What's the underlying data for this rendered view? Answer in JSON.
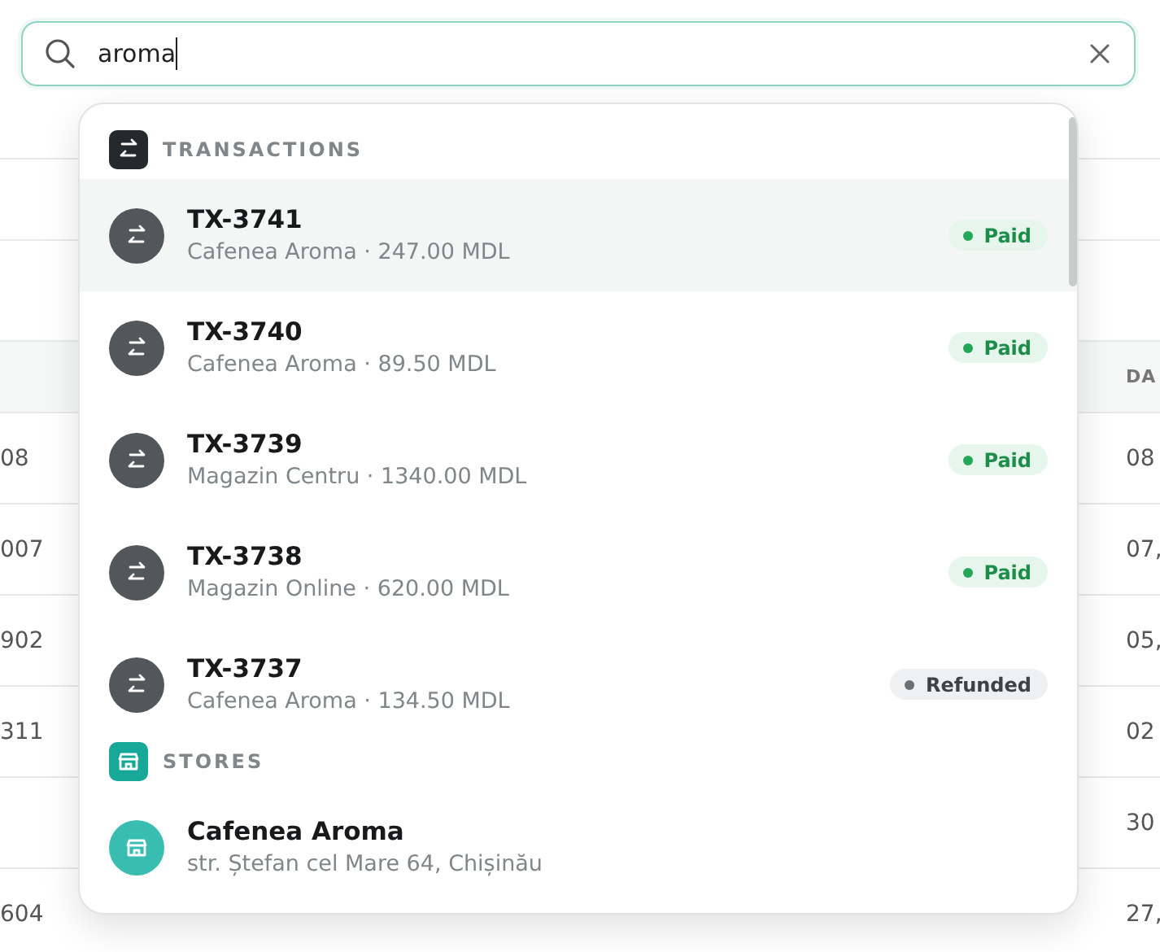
{
  "search": {
    "value": "aroma"
  },
  "table": {
    "header": [
      "DA"
    ],
    "rows": [
      {
        "cells": [
          "08",
          "",
          "",
          "",
          "08"
        ]
      },
      {
        "cells": [
          "007",
          "",
          "",
          "",
          "07,"
        ]
      },
      {
        "cells": [
          "902",
          "",
          "",
          "",
          "05,"
        ]
      },
      {
        "cells": [
          "311",
          "",
          "",
          "",
          "02"
        ]
      },
      {
        "cells": [
          "",
          "",
          "",
          "",
          "30"
        ]
      },
      {
        "cells": [
          "604",
          "",
          "",
          "",
          "27,"
        ]
      }
    ]
  },
  "results": {
    "sections": [
      {
        "kind": "transactions",
        "title": "TRANSACTIONS",
        "items": [
          {
            "title": "TX-3741",
            "subtitle": "Cafenea Aroma · 247.00 MDL",
            "status": "Paid",
            "kind": "paid",
            "selected": true
          },
          {
            "title": "TX-3740",
            "subtitle": "Cafenea Aroma · 89.50 MDL",
            "status": "Paid",
            "kind": "paid",
            "selected": false
          },
          {
            "title": "TX-3739",
            "subtitle": "Magazin Centru · 1340.00 MDL",
            "status": "Paid",
            "kind": "paid",
            "selected": false
          },
          {
            "title": "TX-3738",
            "subtitle": "Magazin Online · 620.00 MDL",
            "status": "Paid",
            "kind": "paid",
            "selected": false
          },
          {
            "title": "TX-3737",
            "subtitle": "Cafenea Aroma · 134.50 MDL",
            "status": "Refunded",
            "kind": "refunded",
            "selected": false
          }
        ]
      },
      {
        "kind": "stores",
        "title": "STORES",
        "items": [
          {
            "title": "Cafenea Aroma",
            "subtitle": "str. Ștefan cel Mare 64, Chișinău",
            "selected": false
          }
        ]
      }
    ]
  }
}
